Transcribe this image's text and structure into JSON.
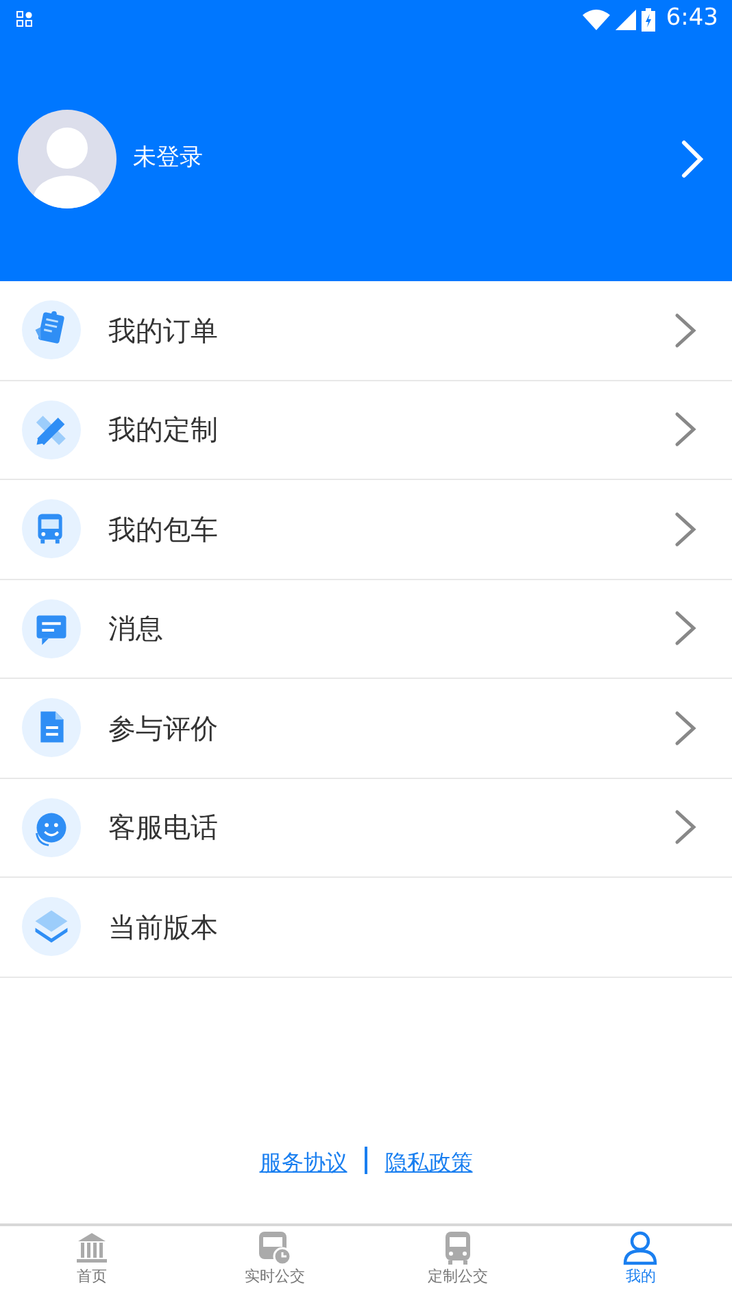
{
  "status_bar": {
    "time": "6:43"
  },
  "profile": {
    "name": "未登录"
  },
  "menu": [
    {
      "label": "我的订单",
      "chevron": true
    },
    {
      "label": "我的定制",
      "chevron": true
    },
    {
      "label": "我的包车",
      "chevron": true
    },
    {
      "label": "消息",
      "chevron": true
    },
    {
      "label": "参与评价",
      "chevron": true
    },
    {
      "label": "客服电话",
      "chevron": true
    },
    {
      "label": "当前版本",
      "chevron": false
    }
  ],
  "footer_links": [
    "服务协议",
    "隐私政策"
  ],
  "tabs": [
    {
      "label": "首页",
      "selected": false
    },
    {
      "label": "实时公交",
      "selected": false
    },
    {
      "label": "定制公交",
      "selected": false
    },
    {
      "label": "我的",
      "selected": true
    }
  ]
}
